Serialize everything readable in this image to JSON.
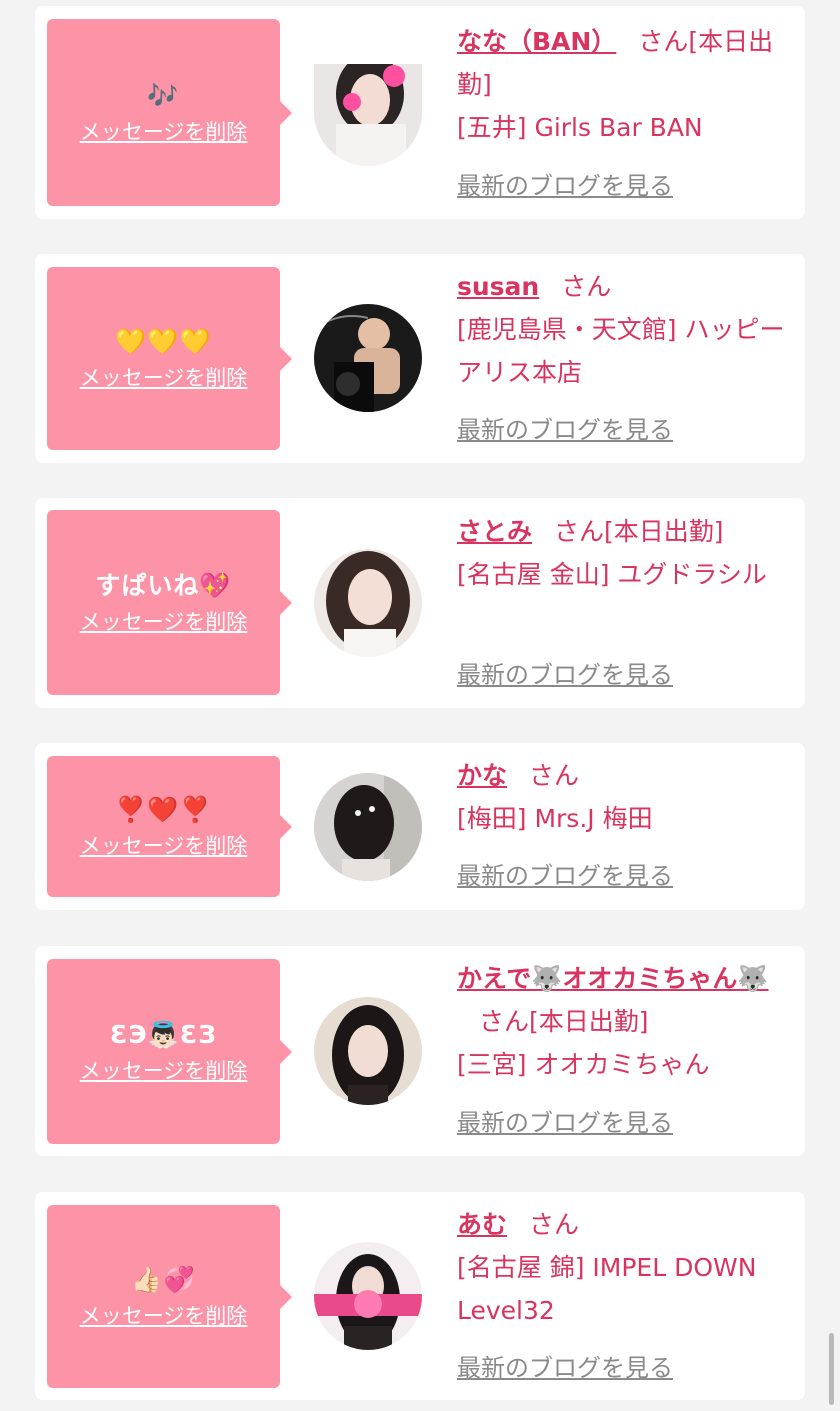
{
  "colors": {
    "background": "#f3f3f3",
    "card": "#ffffff",
    "bubble": "#fd93a6",
    "name_text": "#d9345f",
    "blog_link": "#8a8a8a"
  },
  "cards": [
    {
      "message": "🎶",
      "delete_label": "メッセージを削除",
      "name": "なな（BAN）",
      "suffix": "さん",
      "tag": "[本日出勤]",
      "shop": "[五井] Girls Bar BAN",
      "blog_label": "最新のブログを見る",
      "avatar_icon": "avatar-photo-icon"
    },
    {
      "message": "💛💛💛",
      "delete_label": "メッセージを削除",
      "name": "susan",
      "suffix": "さん",
      "tag": "",
      "shop": "[鹿児島県・天文館] ハッピーアリス本店",
      "blog_label": "最新のブログを見る",
      "avatar_icon": "avatar-photo-icon"
    },
    {
      "message": "すぱいね💖",
      "delete_label": "メッセージを削除",
      "name": "さとみ",
      "suffix": "さん",
      "tag": "[本日出勤]",
      "shop": "[名古屋 金山] ユグドラシル",
      "blog_label": "最新のブログを見る",
      "avatar_icon": "avatar-photo-icon"
    },
    {
      "message": "❣️❤️❣️",
      "delete_label": "メッセージを削除",
      "name": "かな",
      "suffix": "さん",
      "tag": "",
      "shop": "[梅田] Mrs.J 梅田",
      "blog_label": "最新のブログを見る",
      "avatar_icon": "avatar-photo-icon"
    },
    {
      "message": "ƐЭ👼🏻ƐЗ",
      "delete_label": "メッセージを削除",
      "name": "かえで🐺オオカミちゃん🐺",
      "suffix": "さん",
      "tag": "[本日出勤]",
      "shop": "[三宮] オオカミちゃん",
      "blog_label": "最新のブログを見る",
      "avatar_icon": "avatar-photo-icon"
    },
    {
      "message": "👍🏻💞",
      "delete_label": "メッセージを削除",
      "name": "あむ",
      "suffix": "さん",
      "tag": "",
      "shop": "[名古屋 錦] IMPEL DOWN Level32",
      "blog_label": "最新のブログを見る",
      "avatar_icon": "avatar-photo-icon"
    }
  ]
}
